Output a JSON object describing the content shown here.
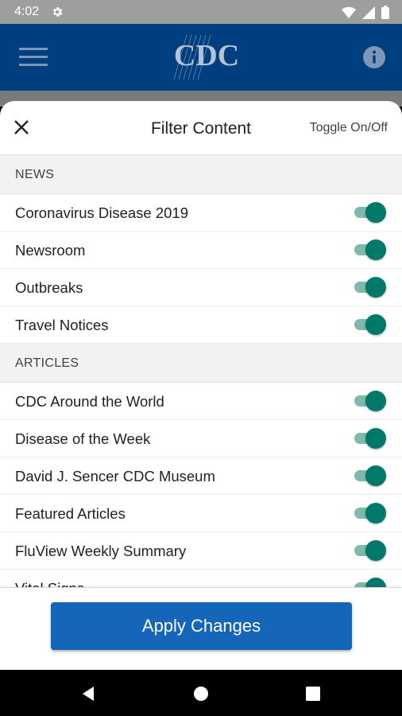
{
  "status_bar": {
    "time": "4:02",
    "icons": [
      "settings-icon",
      "wifi-icon",
      "signal-icon",
      "battery-icon"
    ]
  },
  "app_bar": {
    "logo_text": "CDC",
    "bg_color": "#003f7f",
    "icons": [
      "menu-icon",
      "info-icon"
    ]
  },
  "sheet": {
    "title": "Filter Content",
    "toggle_hint": "Toggle On/Off",
    "sections": [
      {
        "header": "NEWS",
        "items": [
          {
            "label": "Coronavirus Disease 2019",
            "enabled": true
          },
          {
            "label": "Newsroom",
            "enabled": true
          },
          {
            "label": "Outbreaks",
            "enabled": true
          },
          {
            "label": "Travel Notices",
            "enabled": true
          }
        ]
      },
      {
        "header": "ARTICLES",
        "items": [
          {
            "label": "CDC Around the World",
            "enabled": true
          },
          {
            "label": "Disease of the Week",
            "enabled": true
          },
          {
            "label": "David J. Sencer CDC Museum",
            "enabled": true
          },
          {
            "label": "Featured Articles",
            "enabled": true
          },
          {
            "label": "FluView Weekly Summary",
            "enabled": true
          },
          {
            "label": "Vital Signs",
            "enabled": true
          }
        ]
      }
    ],
    "apply_label": "Apply Changes",
    "accent_color": "#1565b8",
    "switch_on_color": "#00796b"
  },
  "nav_bar": {
    "icons": [
      "back-icon",
      "home-icon",
      "recents-icon"
    ]
  }
}
